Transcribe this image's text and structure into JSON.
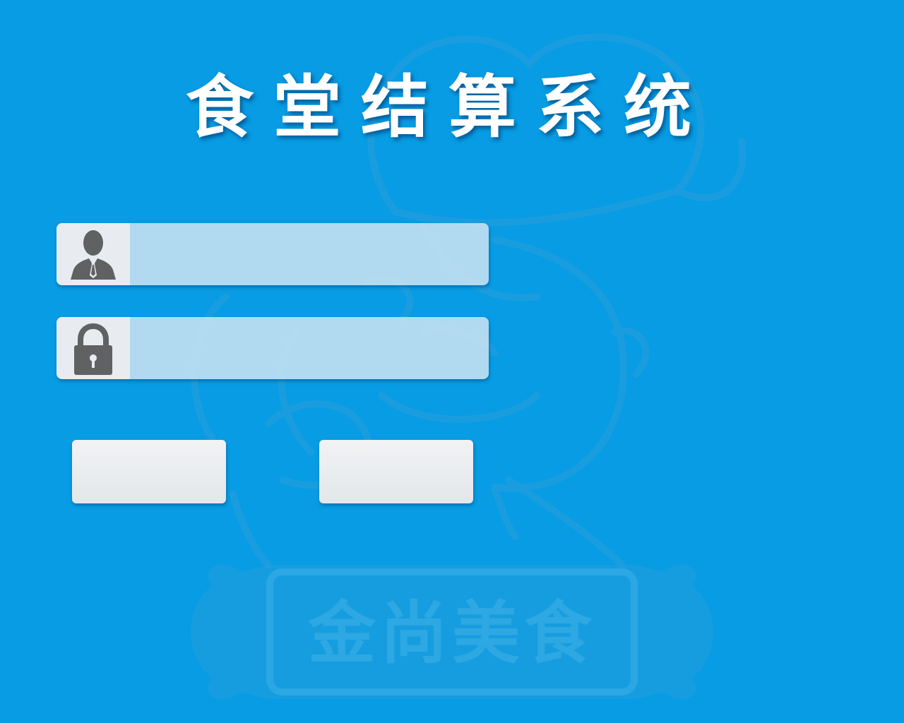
{
  "app": {
    "title": "食堂结算系统",
    "watermark_text": "金尚美食"
  },
  "login": {
    "username": {
      "icon": "user-icon",
      "value": "",
      "placeholder": ""
    },
    "password": {
      "icon": "lock-icon",
      "value": "",
      "placeholder": ""
    },
    "login_button_label": "",
    "cancel_button_label": ""
  },
  "colors": {
    "background": "#079ce4",
    "field_fill": "#d7e8f4",
    "icon_box": "#e8ecf0",
    "icon": "#5f6163",
    "button": "#e8ebee"
  }
}
